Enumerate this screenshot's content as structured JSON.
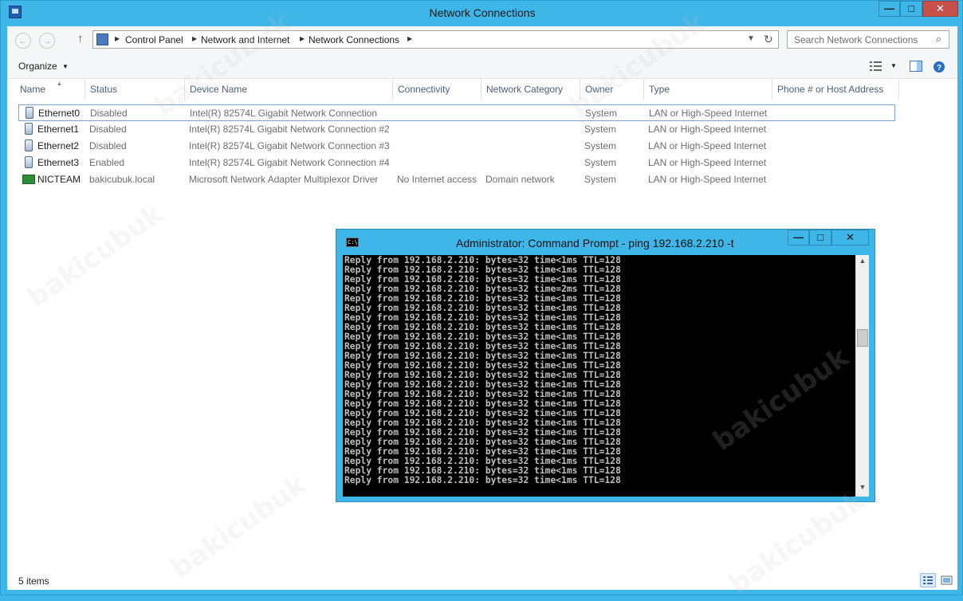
{
  "window": {
    "title": "Network Connections",
    "min": "—",
    "max": "□",
    "close": "✕"
  },
  "nav": {
    "back": "←",
    "forward": "→",
    "up": "↑",
    "crumbs": [
      "Control Panel",
      "Network and Internet",
      "Network Connections"
    ],
    "search_placeholder": "Search Network Connections"
  },
  "toolbar": {
    "organize": "Organize",
    "organize_arrow": "▼"
  },
  "columns": [
    "Name",
    "Status",
    "Device Name",
    "Connectivity",
    "Network Category",
    "Owner",
    "Type",
    "Phone # or Host Address"
  ],
  "rows": [
    {
      "name": "Ethernet0",
      "status": "Disabled",
      "device": "Intel(R) 82574L Gigabit Network Connection",
      "connectivity": "",
      "category": "",
      "owner": "System",
      "type": "LAN or High-Speed Internet"
    },
    {
      "name": "Ethernet1",
      "status": "Disabled",
      "device": "Intel(R) 82574L Gigabit Network Connection #2",
      "connectivity": "",
      "category": "",
      "owner": "System",
      "type": "LAN or High-Speed Internet"
    },
    {
      "name": "Ethernet2",
      "status": "Disabled",
      "device": "Intel(R) 82574L Gigabit Network Connection #3",
      "connectivity": "",
      "category": "",
      "owner": "System",
      "type": "LAN or High-Speed Internet"
    },
    {
      "name": "Ethernet3",
      "status": "Enabled",
      "device": "Intel(R) 82574L Gigabit Network Connection #4",
      "connectivity": "",
      "category": "",
      "owner": "System",
      "type": "LAN or High-Speed Internet"
    },
    {
      "name": "NICTEAM",
      "status": "bakicubuk.local",
      "device": "Microsoft Network Adapter Multiplexor Driver",
      "connectivity": "No Internet access",
      "category": "Domain network",
      "owner": "System",
      "type": "LAN or High-Speed Internet"
    }
  ],
  "statusbar": {
    "items": "5 items"
  },
  "cmd": {
    "title": "Administrator: Command Prompt - ping  192.168.2.210 -t",
    "icon_text": "C:\\",
    "lines": [
      "Reply from 192.168.2.210: bytes=32 time<1ms TTL=128",
      "Reply from 192.168.2.210: bytes=32 time<1ms TTL=128",
      "Reply from 192.168.2.210: bytes=32 time<1ms TTL=128",
      "Reply from 192.168.2.210: bytes=32 time=2ms TTL=128",
      "Reply from 192.168.2.210: bytes=32 time<1ms TTL=128",
      "Reply from 192.168.2.210: bytes=32 time<1ms TTL=128",
      "Reply from 192.168.2.210: bytes=32 time<1ms TTL=128",
      "Reply from 192.168.2.210: bytes=32 time<1ms TTL=128",
      "Reply from 192.168.2.210: bytes=32 time<1ms TTL=128",
      "Reply from 192.168.2.210: bytes=32 time<1ms TTL=128",
      "Reply from 192.168.2.210: bytes=32 time<1ms TTL=128",
      "Reply from 192.168.2.210: bytes=32 time<1ms TTL=128",
      "Reply from 192.168.2.210: bytes=32 time<1ms TTL=128",
      "Reply from 192.168.2.210: bytes=32 time<1ms TTL=128",
      "Reply from 192.168.2.210: bytes=32 time<1ms TTL=128",
      "Reply from 192.168.2.210: bytes=32 time<1ms TTL=128",
      "Reply from 192.168.2.210: bytes=32 time<1ms TTL=128",
      "Reply from 192.168.2.210: bytes=32 time<1ms TTL=128",
      "Reply from 192.168.2.210: bytes=32 time<1ms TTL=128",
      "Reply from 192.168.2.210: bytes=32 time<1ms TTL=128",
      "Reply from 192.168.2.210: bytes=32 time<1ms TTL=128",
      "Reply from 192.168.2.210: bytes=32 time<1ms TTL=128",
      "Reply from 192.168.2.210: bytes=32 time<1ms TTL=128",
      "Reply from 192.168.2.210: bytes=32 time<1ms TTL=128"
    ]
  },
  "watermark": "bakicubuk",
  "colors": {
    "accent": "#3fb6e8",
    "close": "#c7504a",
    "console_bg": "#000000"
  }
}
